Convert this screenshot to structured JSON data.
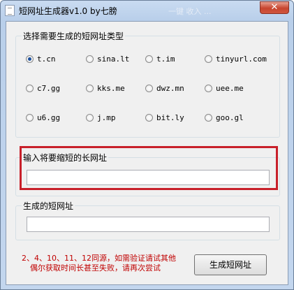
{
  "window": {
    "title": "短网址生成器v1.0  by七膀",
    "ghost_text": "一键 收入 ..."
  },
  "type_group": {
    "title": "选择需要生成的短网址类型",
    "options": [
      "t.cn",
      "sina.lt",
      "t.im",
      "tinyurl.com",
      "c7.gg",
      "kks.me",
      "dwz.mn",
      "uee.me",
      "u6.gg",
      "j.mp",
      "bit.ly",
      "goo.gl"
    ],
    "selected": "t.cn"
  },
  "long_url_group": {
    "title": "输入将要缩短的长网址",
    "value": ""
  },
  "short_url_group": {
    "title": "生成的短网址",
    "value": ""
  },
  "note": {
    "line1": "2、4、10、11、12同源，如需验证请试其他",
    "line2": "偶尔获取时间长甚至失败，请再次尝试"
  },
  "generate_button": {
    "label": "生成短网址"
  },
  "colors": {
    "highlight": "#c8202a",
    "note_text": "#c00000"
  }
}
